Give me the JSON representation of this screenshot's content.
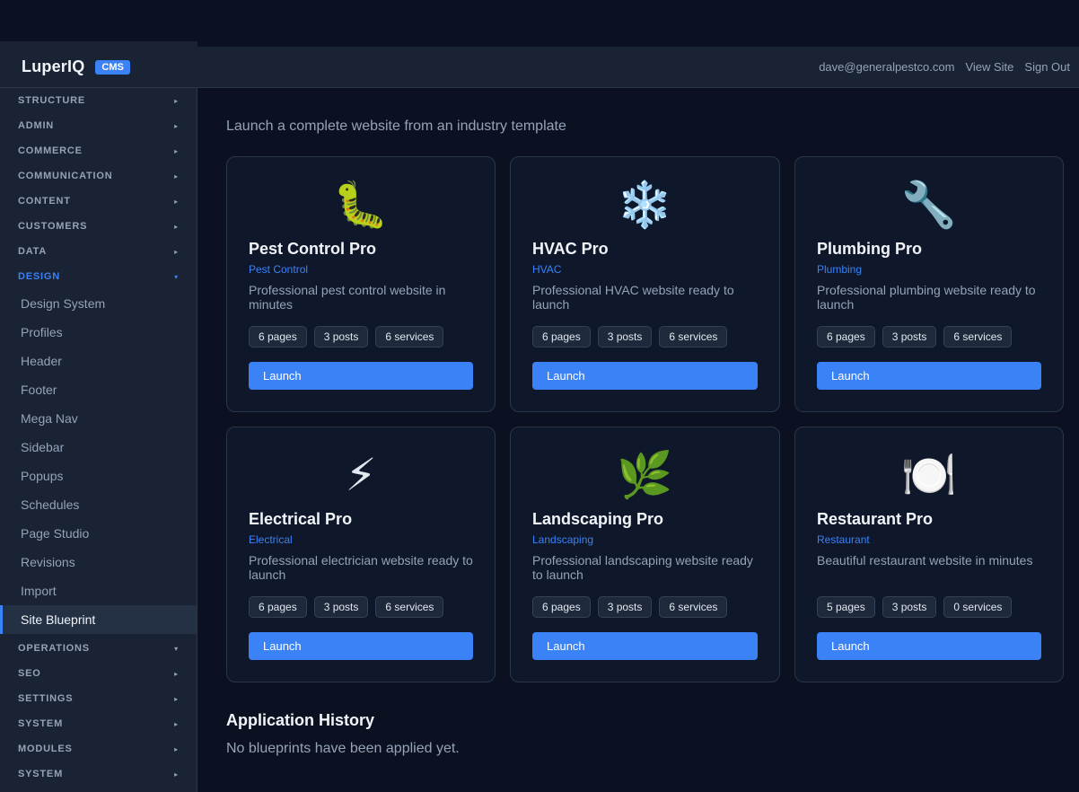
{
  "header": {
    "brand": "LuperIQ",
    "badge": "CMS",
    "user_email": "dave@generalpestco.com",
    "view_site": "View Site",
    "sign_out": "Sign Out"
  },
  "sidebar": {
    "sections_before": [
      {
        "label": "STRUCTURE",
        "arrow": "▸"
      },
      {
        "label": "ADMIN",
        "arrow": "▸"
      },
      {
        "label": "COMMERCE",
        "arrow": "▸"
      },
      {
        "label": "COMMUNICATION",
        "arrow": "▸"
      },
      {
        "label": "CONTENT",
        "arrow": "▸"
      },
      {
        "label": "CUSTOMERS",
        "arrow": "▸"
      },
      {
        "label": "DATA",
        "arrow": "▸"
      }
    ],
    "open_section": {
      "label": "DESIGN",
      "arrow": "▾"
    },
    "design_items": [
      "Design System",
      "Profiles",
      "Header",
      "Footer",
      "Mega Nav",
      "Sidebar",
      "Popups",
      "Schedules",
      "Page Studio",
      "Revisions",
      "Import",
      "Site Blueprint"
    ],
    "sections_after": [
      {
        "label": "OPERATIONS",
        "arrow": "▾"
      },
      {
        "label": "SEO",
        "arrow": "▸"
      },
      {
        "label": "SETTINGS",
        "arrow": "▸"
      },
      {
        "label": "SYSTEM",
        "arrow": "▸"
      },
      {
        "label": "MODULES",
        "arrow": "▸"
      },
      {
        "label": "SYSTEM",
        "arrow": "▸"
      }
    ]
  },
  "main": {
    "intro": "Launch a complete website from an industry template",
    "launch_label": "Launch",
    "cards": [
      {
        "emoji": "🐛",
        "title": "Pest Control Pro",
        "industry": "Pest Control",
        "desc": "Professional pest control website in minutes",
        "pages": "6 pages",
        "posts": "3 posts",
        "services": "6 services"
      },
      {
        "emoji": "❄️",
        "title": "HVAC Pro",
        "industry": "HVAC",
        "desc": "Professional HVAC website ready to launch",
        "pages": "6 pages",
        "posts": "3 posts",
        "services": "6 services"
      },
      {
        "emoji": "🔧",
        "title": "Plumbing Pro",
        "industry": "Plumbing",
        "desc": "Professional plumbing website ready to launch",
        "pages": "6 pages",
        "posts": "3 posts",
        "services": "6 services"
      },
      {
        "emoji": "⚡",
        "title": "Electrical Pro",
        "industry": "Electrical",
        "desc": "Professional electrician website ready to launch",
        "pages": "6 pages",
        "posts": "3 posts",
        "services": "6 services"
      },
      {
        "emoji": "🌿",
        "title": "Landscaping Pro",
        "industry": "Landscaping",
        "desc": "Professional landscaping website ready to launch",
        "pages": "6 pages",
        "posts": "3 posts",
        "services": "6 services"
      },
      {
        "emoji": "🍽️",
        "title": "Restaurant Pro",
        "industry": "Restaurant",
        "desc": "Beautiful restaurant website in minutes",
        "pages": "5 pages",
        "posts": "3 posts",
        "services": "0 services"
      }
    ],
    "history_title": "Application History",
    "history_empty": "No blueprints have been applied yet."
  }
}
